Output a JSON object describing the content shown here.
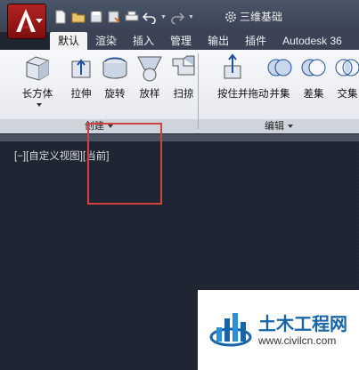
{
  "quick_access": {
    "icons": [
      "new-file-icon",
      "open-folder-icon",
      "save-icon",
      "save-as-icon",
      "print-icon",
      "undo-icon",
      "redo-icon"
    ],
    "workspace": "三维基础"
  },
  "tabs": [
    {
      "label": "默认",
      "active": true
    },
    {
      "label": "渲染"
    },
    {
      "label": "插入"
    },
    {
      "label": "管理"
    },
    {
      "label": "输出"
    },
    {
      "label": "插件"
    },
    {
      "label": "Autodesk 36"
    }
  ],
  "ribbon": {
    "create": {
      "footer": "创建",
      "buttons": [
        {
          "label": "长方体",
          "icon": "box-icon"
        },
        {
          "label": "拉伸",
          "icon": "extrude-icon"
        },
        {
          "label": "旋转",
          "icon": "revolve-icon"
        },
        {
          "label": "放样",
          "icon": "loft-icon"
        },
        {
          "label": "扫掠",
          "icon": "sweep-icon"
        }
      ]
    },
    "edit": {
      "footer": "编辑",
      "buttons": [
        {
          "label": "按住并拖动",
          "icon": "presspull-icon"
        },
        {
          "label": "并集",
          "icon": "union-icon"
        },
        {
          "label": "差集",
          "icon": "subtract-icon"
        },
        {
          "label": "交集",
          "icon": "intersect-icon"
        }
      ]
    }
  },
  "viewport": {
    "label": "[−][自定义视图][当前]"
  },
  "watermark": {
    "title": "土木工程网",
    "url": "www.civilcn.com"
  },
  "colors": {
    "accent_red": "#d24040",
    "app_red": "#b32222",
    "viewport_bg": "#1f2431",
    "watermark_blue": "#1665a8"
  }
}
